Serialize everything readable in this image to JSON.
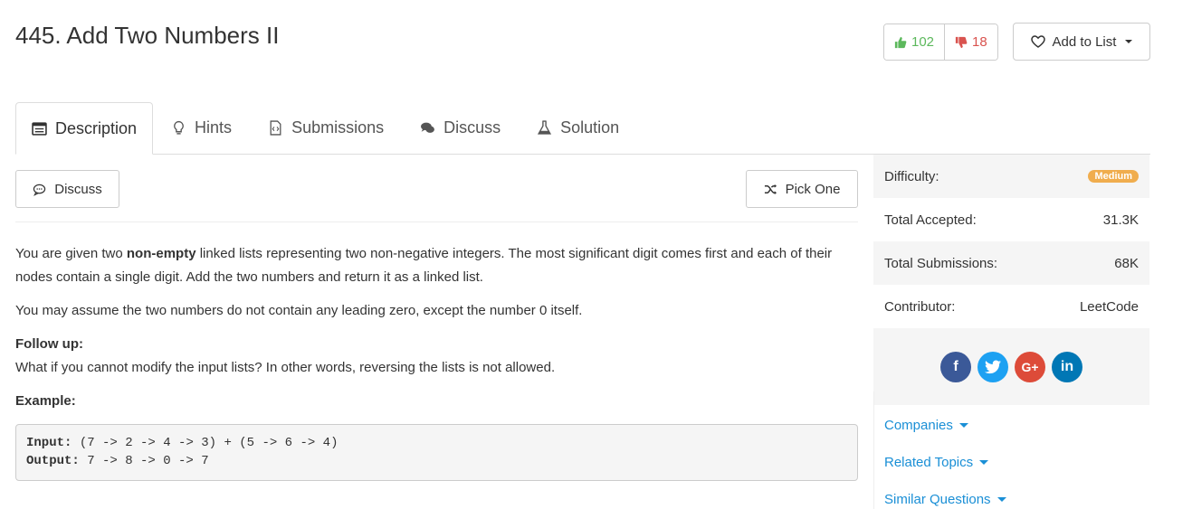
{
  "title": "445. Add Two Numbers II",
  "votes": {
    "up": "102",
    "down": "18"
  },
  "add_to_list": "Add to List",
  "tabs": [
    {
      "label": "Description",
      "icon": "description-icon"
    },
    {
      "label": "Hints",
      "icon": "lightbulb-icon"
    },
    {
      "label": "Submissions",
      "icon": "code-file-icon"
    },
    {
      "label": "Discuss",
      "icon": "comments-icon"
    },
    {
      "label": "Solution",
      "icon": "flask-icon"
    }
  ],
  "discuss_button": "Discuss",
  "pick_one_button": "Pick One",
  "description": {
    "p1_before": "You are given two ",
    "p1_bold": "non-empty",
    "p1_after": " linked lists representing two non-negative integers. The most significant digit comes first and each of their nodes contain a single digit. Add the two numbers and return it as a linked list.",
    "p2": "You may assume the two numbers do not contain any leading zero, except the number 0 itself.",
    "followup_label": "Follow up:",
    "followup_text": "What if you cannot modify the input lists? In other words, reversing the lists is not allowed.",
    "example_label": "Example:",
    "code_input_label": "Input:",
    "code_input": " (7 -> 2 -> 4 -> 3) + (5 -> 6 -> 4)",
    "code_output_label": "Output:",
    "code_output": " 7 -> 8 -> 0 -> 7"
  },
  "sidebar": {
    "difficulty_label": "Difficulty:",
    "difficulty_value": "Medium",
    "accepted_label": "Total Accepted:",
    "accepted_value": "31.3K",
    "submissions_label": "Total Submissions:",
    "submissions_value": "68K",
    "contributor_label": "Contributor:",
    "contributor_value": "LeetCode",
    "social": [
      {
        "name": "facebook",
        "label": "f",
        "color": "#3b5998"
      },
      {
        "name": "twitter",
        "label": "t",
        "color": "#1da1f2"
      },
      {
        "name": "google-plus",
        "label": "G+",
        "color": "#dd4b39"
      },
      {
        "name": "linkedin",
        "label": "in",
        "color": "#0077b5"
      }
    ],
    "companies": "Companies",
    "related_topics": "Related Topics",
    "similar_questions": "Similar Questions"
  },
  "colors": {
    "link": "#1a8fd6",
    "upvote": "#5cb85c",
    "downvote": "#d9534f",
    "medium_badge": "#f0ad4e"
  }
}
